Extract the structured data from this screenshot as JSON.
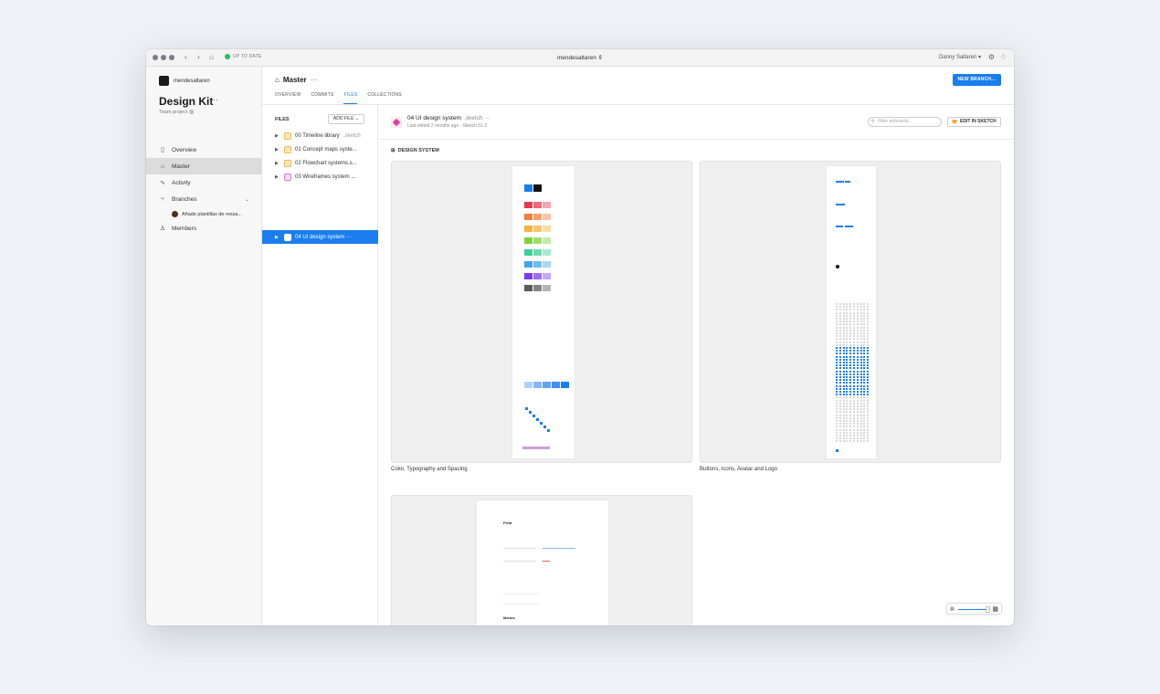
{
  "titlebar": {
    "status": "UP TO DATE",
    "project_title": "mendesaltaren ⇕",
    "user": "Danny Saltaren ▾"
  },
  "sidebar": {
    "org_name": "mendesaltaren",
    "kit_title": "Design Kit",
    "team_label": "Team project ▥",
    "items": [
      {
        "label": "Overview",
        "icon": "document-icon"
      },
      {
        "label": "Master",
        "icon": "branch-master-icon"
      },
      {
        "label": "Activity",
        "icon": "activity-icon"
      },
      {
        "label": "Branches",
        "icon": "branches-icon"
      },
      {
        "label": "Members",
        "icon": "person-icon"
      }
    ],
    "branch_child": "Añade plantillas de ressa..."
  },
  "header": {
    "branch": "Master",
    "tabs": [
      "OVERVIEW",
      "COMMITS",
      "FILES",
      "COLLECTIONS"
    ],
    "active_tab": "FILES",
    "new_branch": "NEW BRANCH..."
  },
  "files": {
    "label": "FILES",
    "add_file": "ADD FILE ⌄",
    "items": [
      {
        "name": "00 Timeline library",
        "ext": ".sketch"
      },
      {
        "name": "01 Concept maps syste...",
        "ext": ""
      },
      {
        "name": "02 Flowchart systems.s...",
        "ext": ""
      },
      {
        "name": "03 Wireframes system ...",
        "ext": ""
      },
      {
        "name": "04 UI design system ···",
        "ext": ""
      }
    ]
  },
  "document": {
    "name": "04 UI design system",
    "ext": ".sketch ···",
    "meta": "Last edited 2 months ago · Sketch 51.2",
    "filter_placeholder": "Filter artboards...",
    "edit_button": "EDIT IN SKETCH",
    "section": "DESIGN SYSTEM",
    "artboards": [
      {
        "label": "Color, Typography and Spacing"
      },
      {
        "label": "Buttons, Icons, Avatar and Logo"
      },
      {
        "label": ""
      }
    ],
    "third_preview_headings": [
      "Field",
      "Menus"
    ]
  },
  "colors": {
    "accent": "#1a7ef0",
    "swatches": [
      "#e8394f",
      "#f37c38",
      "#f5b33a",
      "#7fd13b",
      "#3dcf95",
      "#3ea6ec",
      "#7b3cf0",
      "#5a5a5a"
    ]
  }
}
